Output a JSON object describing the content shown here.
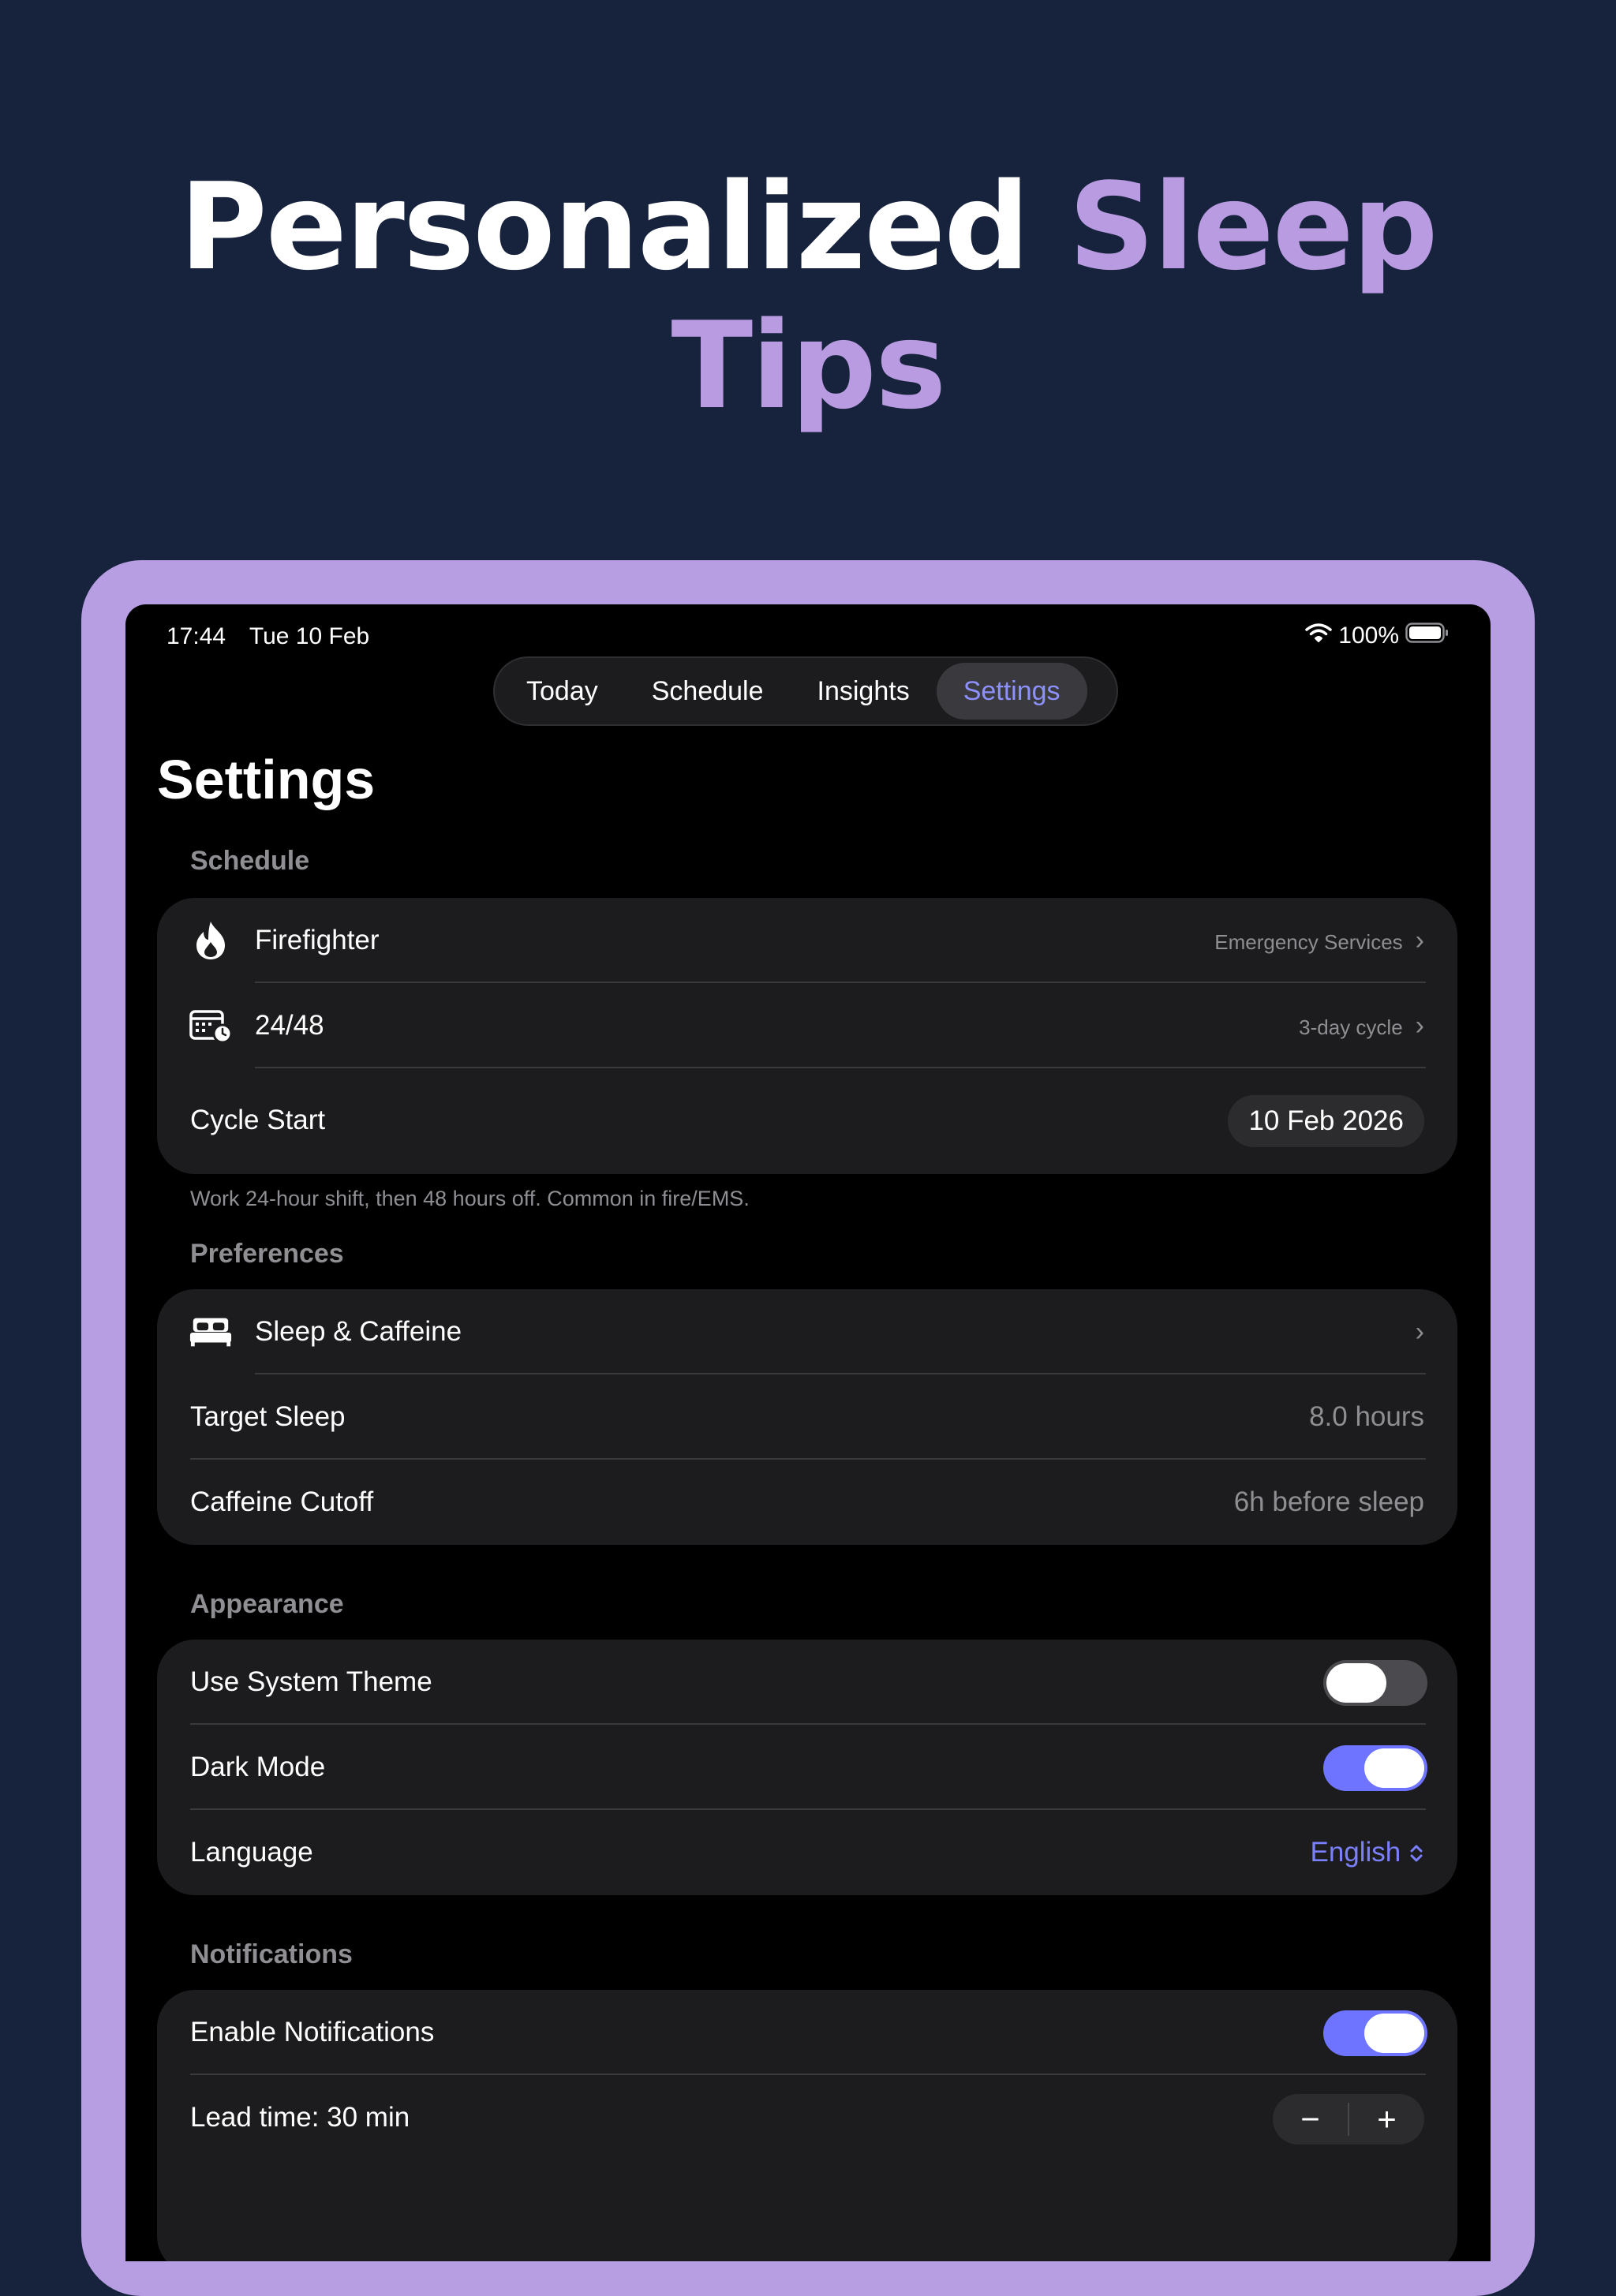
{
  "headline": {
    "part1": "Personalized",
    "part2": "Sleep",
    "part3": "Tips"
  },
  "colors": {
    "background": "#17233d",
    "accent": "#b89be0",
    "frame": "#b79de1",
    "active_tab": "#8d90ff",
    "toggle_on": "#6e74ff"
  },
  "status_bar": {
    "time": "17:44",
    "date": "Tue 10 Feb",
    "battery": "100%",
    "icons": [
      "wifi-icon",
      "battery-icon"
    ]
  },
  "tabs": [
    {
      "label": "Today"
    },
    {
      "label": "Schedule"
    },
    {
      "label": "Insights"
    },
    {
      "label": "Settings",
      "active": true
    }
  ],
  "page_title": "Settings",
  "schedule": {
    "header": "Schedule",
    "profession": {
      "label": "Firefighter",
      "value": "Emergency Services",
      "icon": "flame-icon"
    },
    "rotation": {
      "label": "24/48",
      "value": "3-day cycle",
      "icon": "calendar-clock-icon"
    },
    "cycle_start": {
      "label": "Cycle Start",
      "value": "10 Feb 2026"
    },
    "footnote": "Work 24-hour shift, then 48 hours off. Common in fire/EMS."
  },
  "preferences": {
    "header": "Preferences",
    "sleep_caffeine": {
      "label": "Sleep & Caffeine",
      "icon": "bed-icon"
    },
    "target_sleep": {
      "label": "Target Sleep",
      "value": "8.0 hours"
    },
    "caffeine_cutoff": {
      "label": "Caffeine Cutoff",
      "value": "6h before sleep"
    }
  },
  "appearance": {
    "header": "Appearance",
    "system_theme": {
      "label": "Use System Theme",
      "on": false
    },
    "dark_mode": {
      "label": "Dark Mode",
      "on": true
    },
    "language": {
      "label": "Language",
      "value": "English"
    }
  },
  "notifications": {
    "header": "Notifications",
    "enable": {
      "label": "Enable Notifications",
      "on": true
    },
    "lead_time": {
      "label": "Lead time: 30 min",
      "minus": "−",
      "plus": "+"
    }
  }
}
